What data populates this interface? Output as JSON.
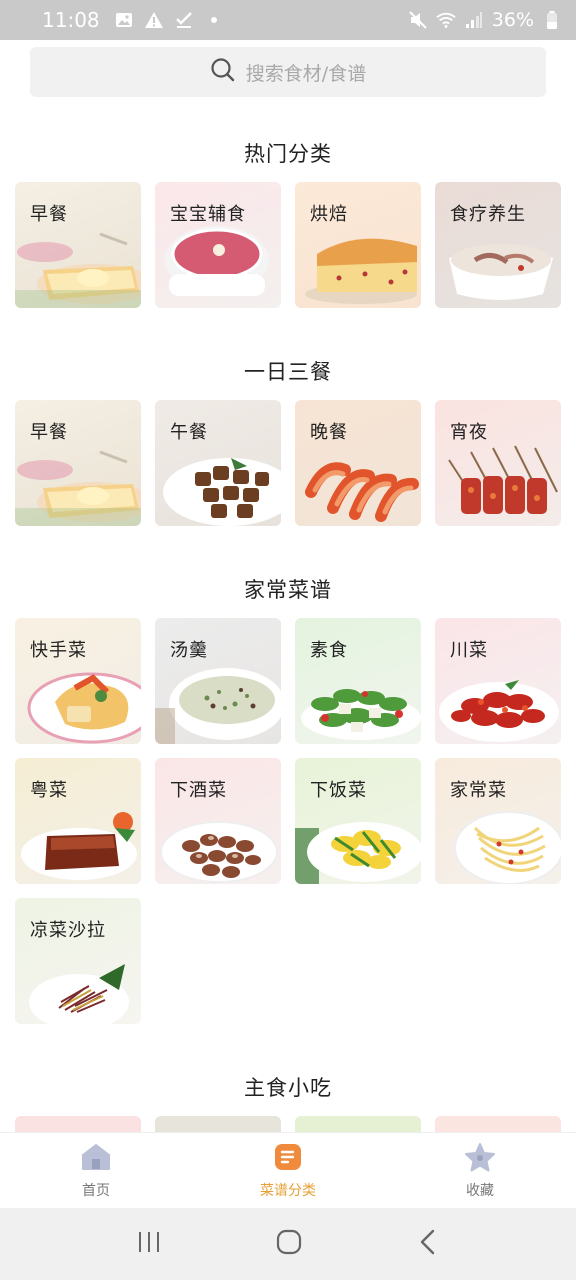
{
  "status_bar": {
    "time": "11:08",
    "battery": "36%"
  },
  "search": {
    "placeholder": "搜索食材/食谱"
  },
  "sections": [
    {
      "title": "热门分类",
      "items": [
        "早餐",
        "宝宝辅食",
        "烘焙",
        "食疗养生"
      ]
    },
    {
      "title": "一日三餐",
      "items": [
        "早餐",
        "午餐",
        "晚餐",
        "宵夜"
      ]
    },
    {
      "title": "家常菜谱",
      "items": [
        "快手菜",
        "汤羹",
        "素食",
        "川菜",
        "粤菜",
        "下酒菜",
        "下饭菜",
        "家常菜",
        "凉菜沙拉"
      ]
    },
    {
      "title": "主食小吃",
      "items": []
    }
  ],
  "bottom_nav": {
    "home": "首页",
    "recipes": "菜谱分类",
    "favorites": "收藏"
  },
  "colors": {
    "accent": "#e5a035",
    "active_tab_icon": "#f08a3c",
    "inactive_icon": "#b9bfd6"
  }
}
